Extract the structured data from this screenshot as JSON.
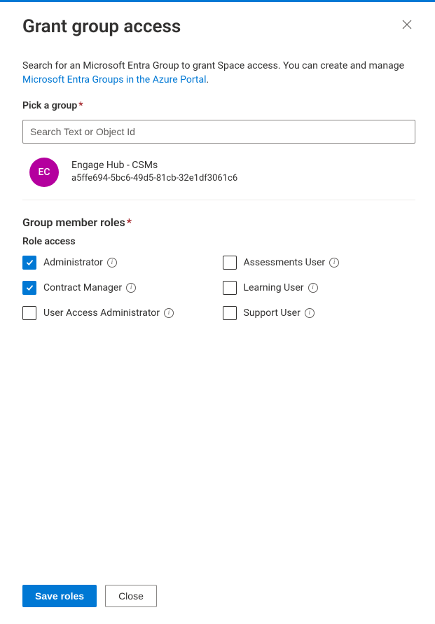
{
  "header": {
    "title": "Grant group access"
  },
  "intro": {
    "text_before_link": "Search for an Microsoft Entra Group to grant Space access. You can create and manage ",
    "link_text": "Microsoft Entra Groups in the Azure Portal",
    "text_after_link": "."
  },
  "pick_group": {
    "label": "Pick a group",
    "placeholder": "Search Text or Object Id"
  },
  "selected_group": {
    "initials": "EC",
    "name": "Engage Hub - CSMs",
    "id": "a5ffe694-5bc6-49d5-81cb-32e1df3061c6",
    "avatar_color": "#b4009e"
  },
  "roles": {
    "header": "Group member roles",
    "subheader": "Role access",
    "items": [
      {
        "label": "Administrator",
        "checked": true
      },
      {
        "label": "Assessments User",
        "checked": false
      },
      {
        "label": "Contract Manager",
        "checked": true
      },
      {
        "label": "Learning User",
        "checked": false
      },
      {
        "label": "User Access Administrator",
        "checked": false
      },
      {
        "label": "Support User",
        "checked": false
      }
    ]
  },
  "footer": {
    "save": "Save roles",
    "close": "Close"
  }
}
